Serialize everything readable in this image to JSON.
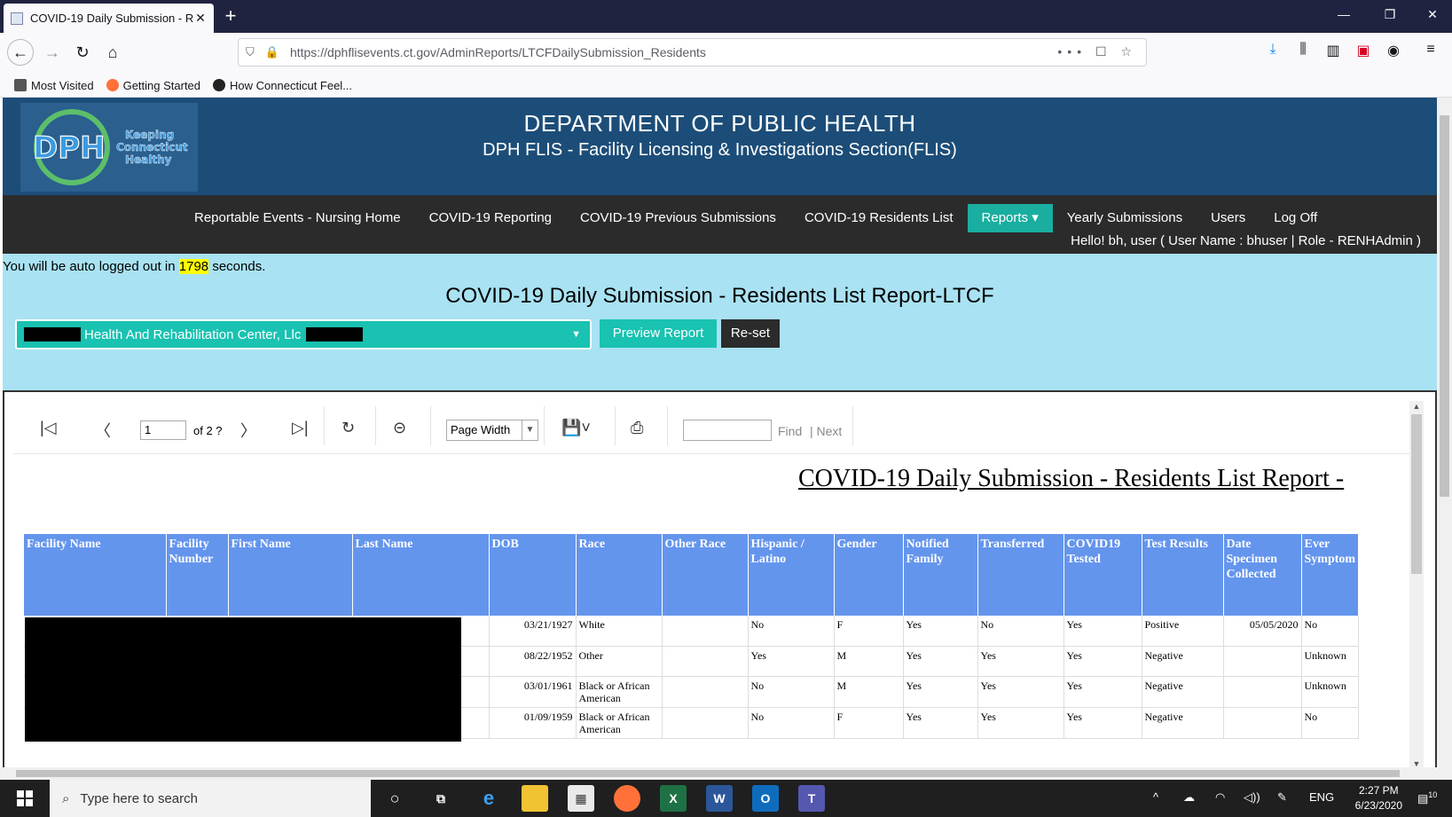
{
  "browser": {
    "tab_title": "COVID-19 Daily Submission - R",
    "url": "https://dphflisevents.ct.gov/AdminReports/LTCFDailySubmission_Residents",
    "bookmarks": [
      "Most Visited",
      "Getting Started",
      "How Connecticut Feel..."
    ]
  },
  "header": {
    "title": "DEPARTMENT OF PUBLIC HEALTH",
    "subtitle": "DPH FLIS - Facility Licensing & Investigations Section(FLIS)",
    "logo_text": "DPH",
    "logo_tagline": [
      "Keeping",
      "Connecticut",
      "Healthy"
    ]
  },
  "menu": [
    "Reportable Events - Nursing Home",
    "COVID-19 Reporting",
    "COVID-19 Previous Submissions",
    "COVID-19 Residents List",
    "Reports ▾",
    "Yearly Submissions",
    "Users",
    "Log Off"
  ],
  "user_greeting": "Hello! bh, user ( User Name : bhuser | Role - RENHAdmin )",
  "autologout": {
    "prefix": "You will be auto logged out in",
    "seconds": "1798",
    "suffix": "seconds."
  },
  "page_title": "COVID-19 Daily Submission - Residents List Report-LTCF",
  "facility": {
    "name": "Health And Rehabilitation Center, Llc"
  },
  "buttons": {
    "preview": "Preview Report",
    "reset": "Re-set"
  },
  "viewer": {
    "page_current": "1",
    "page_of": "of 2 ?",
    "zoom": "Page Width",
    "find": "Find",
    "next": "| Next"
  },
  "report": {
    "heading": "COVID-19 Daily Submission - Residents List Report -",
    "columns": [
      "Facility Name",
      "Facility Number",
      "First Name",
      "Last Name",
      "DOB",
      "Race",
      "Other Race",
      "Hispanic / Latino",
      "Gender",
      "Notified Family",
      "Transferred",
      "COVID19 Tested",
      "Test Results",
      "Date Specimen Collected",
      "Ever Symptom"
    ],
    "rows": [
      [
        "",
        "",
        "",
        "",
        "03/21/1927",
        "White",
        "",
        "No",
        "F",
        "Yes",
        "No",
        "Yes",
        "Positive",
        "05/05/2020",
        "No"
      ],
      [
        "",
        "",
        "",
        "",
        "08/22/1952",
        "Other",
        "",
        "Yes",
        "M",
        "Yes",
        "Yes",
        "Yes",
        "Negative",
        "",
        "Unknown"
      ],
      [
        "",
        "",
        "",
        "",
        "03/01/1961",
        "Black or African American",
        "",
        "No",
        "M",
        "Yes",
        "Yes",
        "Yes",
        "Negative",
        "",
        "Unknown"
      ],
      [
        "",
        "",
        "",
        "",
        "01/09/1959",
        "Black or African American",
        "",
        "No",
        "F",
        "Yes",
        "Yes",
        "Yes",
        "Negative",
        "",
        "No"
      ]
    ]
  },
  "taskbar": {
    "search_placeholder": "Type here to search",
    "lang": "ENG",
    "time": "2:27 PM",
    "date": "6/23/2020",
    "notif_count": "10"
  },
  "colors": {
    "header_bg": "#1c4d78",
    "menu_bg": "#2b2b2b",
    "accent_teal": "#1aaea0",
    "page_bg": "#a9e2f2",
    "table_header": "#6495ed"
  }
}
